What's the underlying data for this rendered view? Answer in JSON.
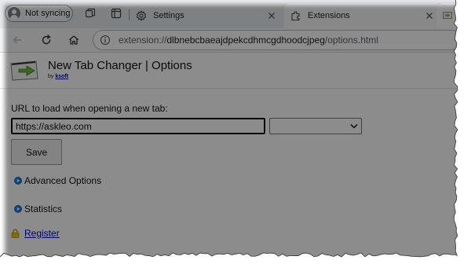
{
  "tabstrip": {
    "profile_label": "Not syncing",
    "tabs": [
      {
        "label": "Settings",
        "icon": "gear-icon",
        "active": false
      },
      {
        "label": "Extensions",
        "icon": "puzzle-icon",
        "active": true
      }
    ]
  },
  "toolbar": {
    "url_scheme": "extension://",
    "url_host": "dlbnebcbaeajdpekcdhmcgdhoodcjpeg",
    "url_path": "/options.html"
  },
  "page": {
    "title": "New Tab Changer | Options",
    "byline_prefix": "by",
    "author_link": "ksoft",
    "url_label": "URL to load when opening a new tab:",
    "url_value": "https://askleo.com",
    "preset_value": "",
    "save_label": "Save",
    "advanced_options_label": "Advanced Options",
    "statistics_label": "Statistics",
    "register_label": "Register"
  },
  "colors": {
    "accent_blue": "#1a73e8",
    "link_blue": "#0000cc",
    "logo_green": "#6dbb3b"
  }
}
